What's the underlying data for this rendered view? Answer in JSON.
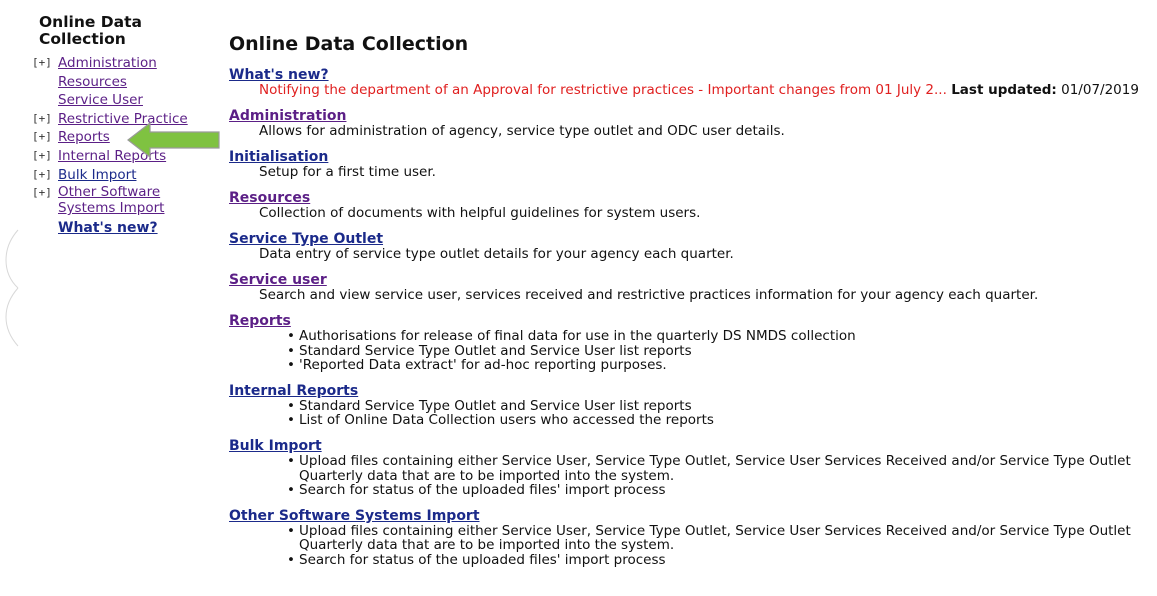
{
  "sidebar": {
    "title": "Online Data Collection",
    "items": [
      {
        "toggle": "[+]",
        "label": "Administration"
      },
      {
        "toggle": "",
        "label": "Resources"
      },
      {
        "toggle": "",
        "label": "Service User"
      },
      {
        "toggle": "[+]",
        "label": "Restrictive Practice"
      },
      {
        "toggle": "[+]",
        "label": "Reports"
      },
      {
        "toggle": "[+]",
        "label": "Internal Reports"
      },
      {
        "toggle": "[+]",
        "label": "Bulk Import"
      },
      {
        "toggle": "[+]",
        "label": "Other Software Systems Import"
      },
      {
        "toggle": "",
        "label": "What's new?"
      }
    ]
  },
  "main": {
    "title": "Online Data Collection",
    "whats_new": {
      "heading": "What's new?",
      "text": "Notifying the department of an Approval for restrictive practices - Important changes from 01 July 2...",
      "updated_label": "Last updated:",
      "updated_date": "01/07/2019"
    },
    "sections": [
      {
        "heading": "Administration",
        "desc": "Allows for administration of agency, service type outlet and ODC user details."
      },
      {
        "heading": "Initialisation",
        "desc": "Setup for a first time user."
      },
      {
        "heading": "Resources",
        "desc": "Collection of documents with helpful guidelines for system users."
      },
      {
        "heading": "Service Type Outlet",
        "desc": "Data entry of service type outlet details for your agency each quarter."
      },
      {
        "heading": "Service user",
        "desc": "Search and view service user, services received and restrictive practices information for your agency each quarter."
      },
      {
        "heading": "Reports",
        "bullets": [
          "Authorisations for release of final data for use in the quarterly DS NMDS collection",
          "Standard Service Type Outlet and Service User list reports",
          "'Reported Data extract' for ad-hoc reporting purposes."
        ]
      },
      {
        "heading": "Internal Reports",
        "bullets": [
          "Standard Service Type Outlet and Service User list reports",
          "List of Online Data Collection users who accessed the reports"
        ]
      },
      {
        "heading": "Bulk Import",
        "bullets": [
          "Upload files containing either Service User, Service Type Outlet, Service User Services Received and/or Service Type Outlet Quarterly data that are to be imported into the system.",
          "Search for status of the uploaded files' import process"
        ]
      },
      {
        "heading": "Other Software Systems Import",
        "bullets": [
          "Upload files containing either Service User, Service Type Outlet, Service User Services Received and/or Service Type Outlet Quarterly data that are to be imported into the system.",
          "Search for status of the uploaded files' import process"
        ]
      }
    ]
  },
  "annotation": {
    "icon": "arrow-left-icon",
    "color": "#7fc241"
  }
}
